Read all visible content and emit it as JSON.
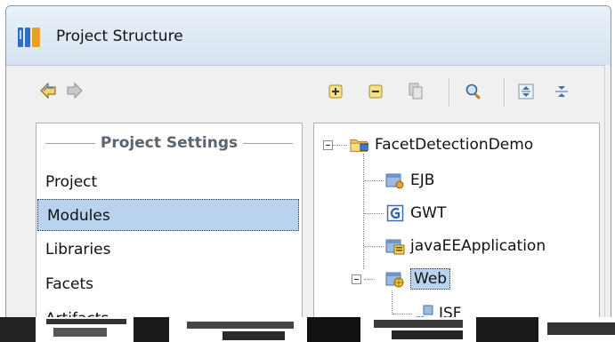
{
  "window": {
    "title": "Project Structure"
  },
  "left_panel": {
    "section_title": "Project Settings",
    "items": [
      {
        "label": "Project",
        "selected": false
      },
      {
        "label": "Modules",
        "selected": true
      },
      {
        "label": "Libraries",
        "selected": false
      },
      {
        "label": "Facets",
        "selected": false
      },
      {
        "label": "Artifacts",
        "selected": false
      }
    ]
  },
  "tree": {
    "root": {
      "label": "FacetDetectionDemo",
      "icon": "module-folder-icon"
    },
    "children": [
      {
        "label": "EJB",
        "icon": "ejb-facet-icon"
      },
      {
        "label": "GWT",
        "icon": "gwt-facet-icon"
      },
      {
        "label": "javaEEApplication",
        "icon": "javaee-facet-icon"
      },
      {
        "label": "Web",
        "icon": "web-facet-icon",
        "selected": true,
        "expanded": true,
        "children": [
          {
            "label": "JSF",
            "icon": "jsf-facet-icon"
          }
        ]
      }
    ]
  },
  "colors": {
    "selection": "#b9d3ee",
    "titlebar": "#dbe6f2",
    "accent_blue": "#2b6fc7"
  }
}
